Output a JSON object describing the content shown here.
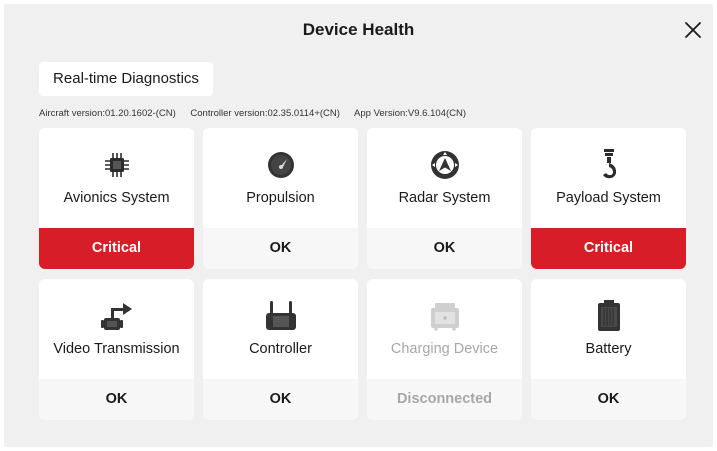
{
  "header": {
    "title": "Device Health",
    "close_icon": "close-icon"
  },
  "diagnostics_button": "Real-time Diagnostics",
  "versions": {
    "aircraft": "Aircraft version:01.20.1602-(CN)",
    "controller": "Controller version:02.35.0114+(CN)",
    "app": "App Version:V9.6.104(CN)"
  },
  "colors": {
    "critical": "#d71d28",
    "background": "#f0f0f0",
    "card": "#ffffff"
  },
  "cards": [
    {
      "name": "Avionics System",
      "status": "Critical",
      "icon": "chip-icon"
    },
    {
      "name": "Propulsion",
      "status": "OK",
      "icon": "gauge-icon"
    },
    {
      "name": "Radar System",
      "status": "OK",
      "icon": "radar-icon"
    },
    {
      "name": "Payload System",
      "status": "Critical",
      "icon": "hook-icon"
    },
    {
      "name": "Video Transmission",
      "status": "OK",
      "icon": "video-transmission-icon"
    },
    {
      "name": "Controller",
      "status": "OK",
      "icon": "remote-controller-icon"
    },
    {
      "name": "Charging Device",
      "status": "Disconnected",
      "icon": "charging-hub-icon"
    },
    {
      "name": "Battery",
      "status": "OK",
      "icon": "battery-icon"
    }
  ]
}
